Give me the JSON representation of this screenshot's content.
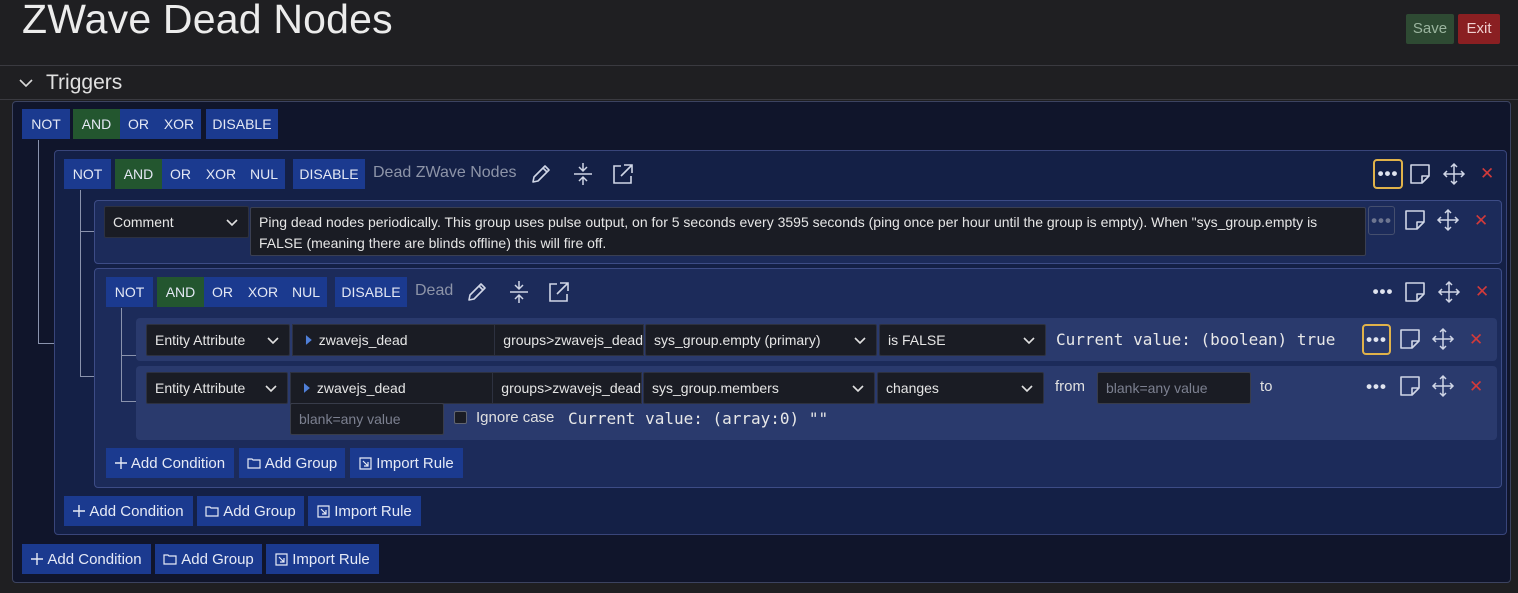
{
  "header": {
    "title": "ZWave Dead Nodes",
    "save_label": "Save",
    "exit_label": "Exit"
  },
  "section": {
    "title": "Triggers"
  },
  "toggles": {
    "not": "NOT",
    "and": "AND",
    "or": "OR",
    "xor": "XOR",
    "nul": "NUL",
    "disable": "DISABLE"
  },
  "groups": {
    "outer": {
      "label": "Dead ZWave Nodes"
    },
    "inner": {
      "label": "Dead"
    }
  },
  "comment": {
    "type_label": "Comment",
    "text": "Ping dead nodes periodically.  This group uses pulse output, on for 5 seconds every 3595 seconds (ping once per hour until the group is empty).  When \"sys_group.empty is FALSE (meaning there are blinds offline) this will fire off."
  },
  "conditions": [
    {
      "type_label": "Entity Attribute",
      "entity_name": "zwavejs_dead",
      "entity_path": "groups>zwavejs_dead",
      "attribute": "sys_group.empty (primary)",
      "operator": "is FALSE",
      "current_value": "Current value: (boolean) true"
    },
    {
      "type_label": "Entity Attribute",
      "entity_name": "zwavejs_dead",
      "entity_path": "groups>zwavejs_dead",
      "attribute": "sys_group.members",
      "operator": "changes",
      "from_label": "from",
      "to_label": "to",
      "from_placeholder": "blank=any value",
      "to_placeholder": "blank=any value",
      "ignore_case_label": "Ignore case",
      "current_value": "Current value: (array:0) \"\""
    }
  ],
  "actions": {
    "add_condition": "Add Condition",
    "add_group": "Add Group",
    "import_rule": "Import Rule"
  },
  "more_glyph": "•••",
  "close_glyph": "✕",
  "colors": {
    "toggle_blue": "#1b3a8f",
    "toggle_on_green": "#23562f",
    "delete_red": "#d23a3a",
    "focus_yellow": "#e0b24a"
  },
  "icons": [
    "chevron-down-icon",
    "pencil-icon",
    "collapse-icon",
    "external-link-icon",
    "more-icon",
    "notes-icon",
    "move-icon",
    "close-icon",
    "plus-icon",
    "folder-add-icon",
    "import-icon",
    "caret-right-icon"
  ]
}
